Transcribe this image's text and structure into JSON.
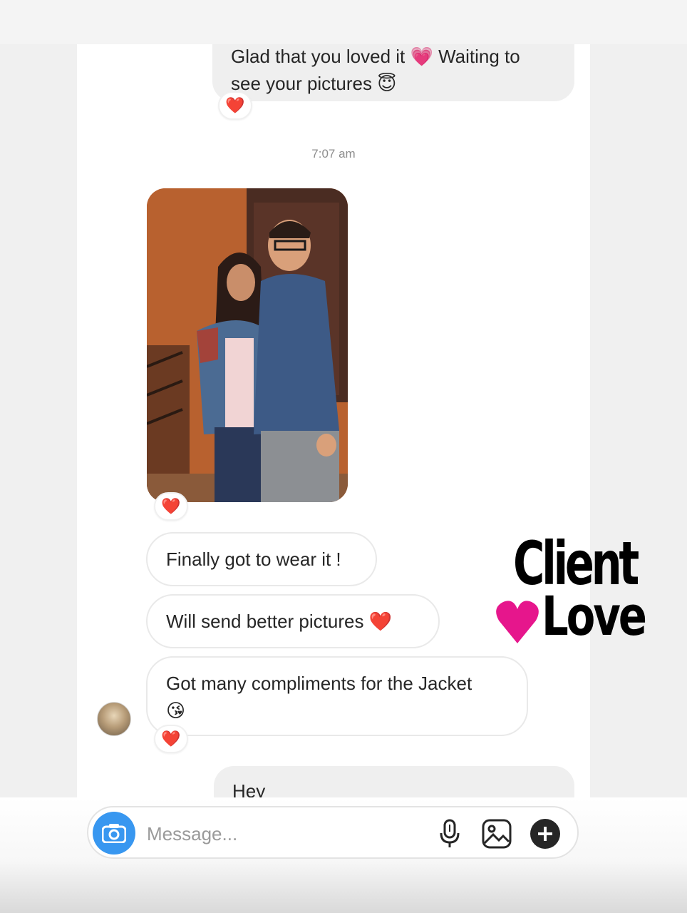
{
  "thread": {
    "top_sent_message": {
      "line1": "Glad that you loved it 💗 Waiting to",
      "line2": "see your pictures 😇",
      "reaction": "❤️"
    },
    "timestamp": "7:07 am",
    "photo": {
      "reaction": "❤️"
    },
    "received_messages": [
      {
        "text": "Finally got to wear it !"
      },
      {
        "text": "Will send better pictures ❤️"
      },
      {
        "line1": "Got many compliments for the Jacket",
        "line2": "😘",
        "reaction": "❤️"
      }
    ],
    "bottom_sent_message": {
      "text": "Hey"
    }
  },
  "composer": {
    "placeholder": "Message..."
  },
  "sticker": {
    "line1": "Client",
    "line2": "Love",
    "heart_color": "#e6168c"
  },
  "colors": {
    "accent": "#3897f0",
    "sent_bubble": "#efefef",
    "reaction_heart": "#e0245e"
  }
}
